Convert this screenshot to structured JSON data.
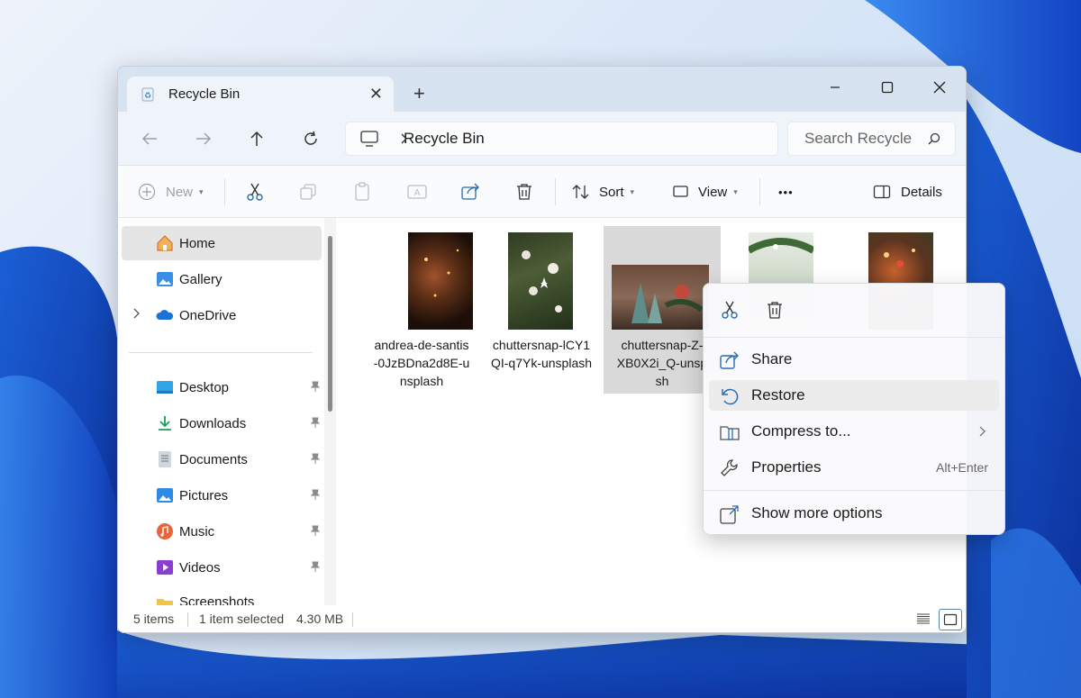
{
  "window": {
    "tab_title": "Recycle Bin",
    "close_tab": "✕",
    "new_tab": "+"
  },
  "address": {
    "crumb": "Recycle Bin",
    "search_placeholder": "Search Recycle"
  },
  "toolbar": {
    "new_label": "New",
    "sort_label": "Sort",
    "view_label": "View",
    "more_label": "•••",
    "details_label": "Details"
  },
  "sidebar": {
    "items": [
      {
        "label": "Home"
      },
      {
        "label": "Gallery"
      },
      {
        "label": "OneDrive"
      },
      {
        "label": "Desktop"
      },
      {
        "label": "Downloads"
      },
      {
        "label": "Documents"
      },
      {
        "label": "Pictures"
      },
      {
        "label": "Music"
      },
      {
        "label": "Videos"
      },
      {
        "label": "Screenshots"
      }
    ]
  },
  "files": [
    {
      "name": "andrea-de-santis-0JzBDna2d8E-unsplash",
      "lines": [
        "andrea-de-santis",
        "-0JzBDna2d8E-u",
        "nsplash"
      ]
    },
    {
      "name": "chuttersnap-lCY1QI-q7Yk-unsplash",
      "lines": [
        "chuttersnap-lCY1",
        "QI-q7Yk-unsplash"
      ]
    },
    {
      "name": "chuttersnap-Z-XB0X2i_Q-unsplash",
      "lines": [
        "chuttersnap-Z-",
        "XB0X2i_Q-unsp",
        "sh"
      ]
    }
  ],
  "status": {
    "items_count": "5 items",
    "selection": "1 item selected",
    "size": "4.30 MB"
  },
  "context_menu": {
    "items": [
      {
        "label": "Share",
        "shortcut": ""
      },
      {
        "label": "Restore",
        "shortcut": ""
      },
      {
        "label": "Compress to...",
        "shortcut": ""
      },
      {
        "label": "Properties",
        "shortcut": "Alt+Enter"
      },
      {
        "label": "Show more options",
        "shortcut": ""
      }
    ]
  },
  "colors": {
    "accent": "#0067c0",
    "titlebar": "#d8e3f1",
    "selection": "#d9d9d9"
  }
}
